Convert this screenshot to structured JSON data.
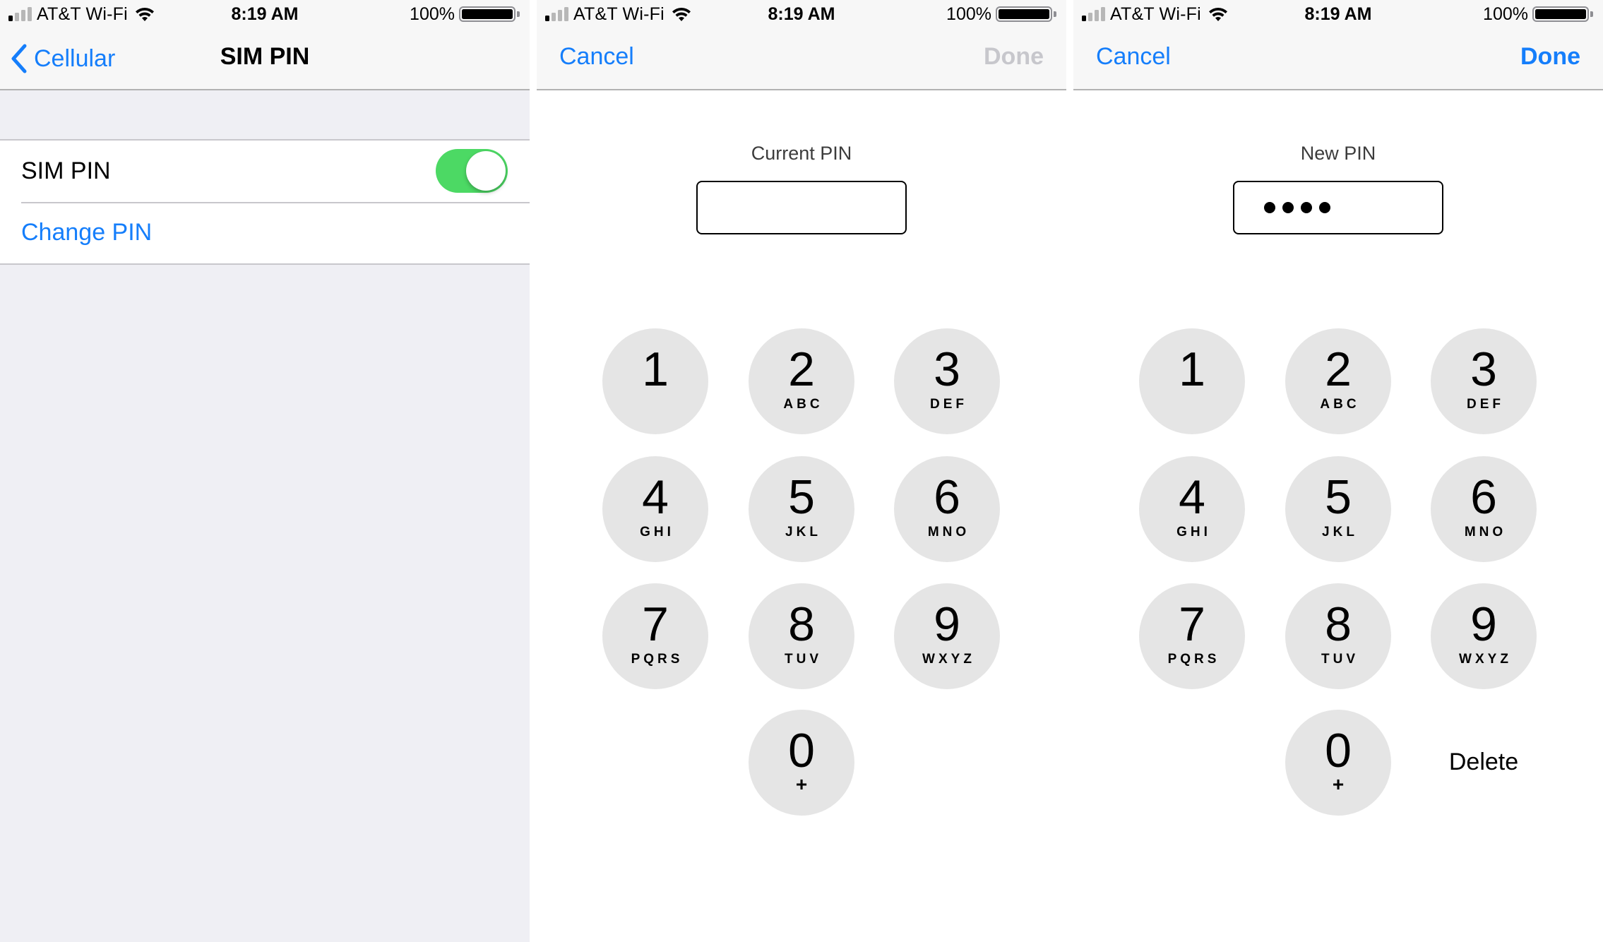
{
  "status_bar": {
    "carrier": "AT&T Wi-Fi",
    "time": "8:19 AM",
    "battery_percent": "100%",
    "signal_bars_active": 1,
    "signal_bars_total": 4
  },
  "colors": {
    "accent": "#157efb",
    "toggle_on": "#4cd964",
    "disabled": "#c7c7cc",
    "key_bg": "#e5e5e5",
    "group_bg": "#efeff4"
  },
  "panel1": {
    "nav": {
      "back_label": "Cellular",
      "title": "SIM PIN",
      "back_icon": "chevron-left-icon"
    },
    "rows": [
      {
        "label": "SIM PIN",
        "toggle_on": true
      },
      {
        "label": "Change PIN"
      }
    ]
  },
  "panel2": {
    "nav": {
      "cancel_label": "Cancel",
      "done_label": "Done",
      "done_enabled": false
    },
    "pin_label": "Current PIN",
    "pin_length": 0
  },
  "panel3": {
    "nav": {
      "cancel_label": "Cancel",
      "done_label": "Done",
      "done_enabled": true
    },
    "pin_label": "New PIN",
    "pin_length": 4,
    "delete_label": "Delete"
  },
  "keypad": [
    {
      "digit": "1",
      "letters": ""
    },
    {
      "digit": "2",
      "letters": "ABC"
    },
    {
      "digit": "3",
      "letters": "DEF"
    },
    {
      "digit": "4",
      "letters": "GHI"
    },
    {
      "digit": "5",
      "letters": "JKL"
    },
    {
      "digit": "6",
      "letters": "MNO"
    },
    {
      "digit": "7",
      "letters": "PQRS"
    },
    {
      "digit": "8",
      "letters": "TUV"
    },
    {
      "digit": "9",
      "letters": "WXYZ"
    },
    {
      "digit": "0",
      "letters": "+"
    }
  ]
}
